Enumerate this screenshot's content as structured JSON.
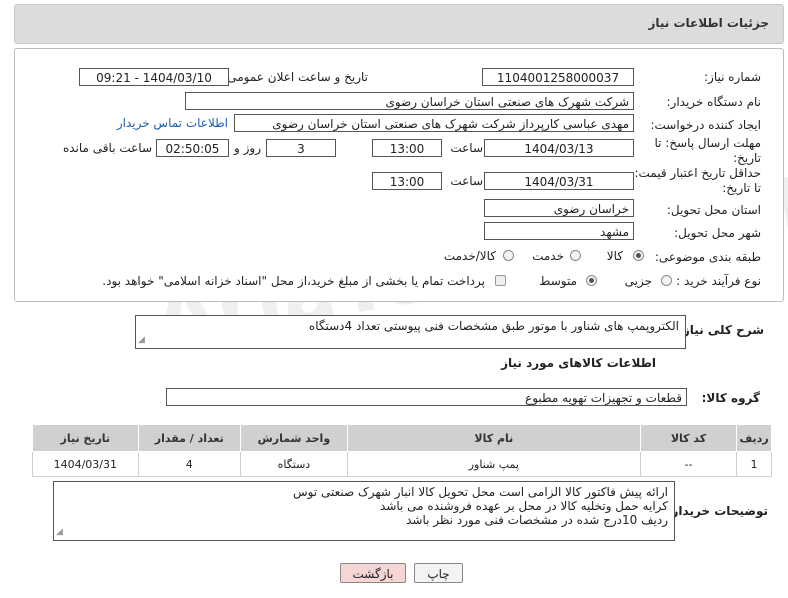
{
  "header": {
    "title": "جزئیات اطلاعات نیاز"
  },
  "form": {
    "need_number_label": "شماره نیاز:",
    "need_number": "1104001258000037",
    "announce_label": "تاریخ و ساعت اعلان عمومی:",
    "announce_value": "1404/03/10 - 09:21",
    "buyer_org_label": "نام دستگاه خریدار:",
    "buyer_org": "شرکت شهرک های صنعتی استان خراسان رضوی",
    "creator_label": "ایجاد کننده درخواست:",
    "creator": "مهدی عباسی کارپرداز شرکت شهرک های صنعتی استان خراسان رضوی",
    "contact_link": "اطلاعات تماس خریدار",
    "deadline_label_1": "مهلت ارسال پاسخ: تا",
    "deadline_label_2": "تاریخ:",
    "deadline_date": "1404/03/13",
    "hour_label": "ساعت",
    "deadline_time": "13:00",
    "days_value": "3",
    "days_label": "روز و",
    "remaining_time": "02:50:05",
    "remaining_label": "ساعت باقی مانده",
    "validity_label_1": "حداقل تاریخ اعتبار قیمت:",
    "validity_label_2": "تا تاریخ:",
    "validity_date": "1404/03/31",
    "validity_time": "13:00",
    "province_label": "استان محل تحویل:",
    "province": "خراسان رضوی",
    "city_label": "شهر محل تحویل:",
    "city": "مشهد",
    "category_label": "طبقه بندی موضوعی:",
    "category_options": [
      "کالا",
      "خدمت",
      "کالا/خدمت"
    ],
    "process_label": "نوع فرآیند خرید :",
    "process_options": [
      "جزیی",
      "متوسط"
    ],
    "payment_note": "پرداخت تمام یا بخشی از مبلغ خرید،از محل \"اسناد خزانه اسلامی\" خواهد بود."
  },
  "description": {
    "label": "شرح کلی نیاز:",
    "text": "الکتروپمپ های شناور با موتور طبق مشخصات فنی پیوستی      تعداد 4دستگاه"
  },
  "goods": {
    "section_title": "اطلاعات کالاهای مورد نیاز",
    "group_label": "گروه کالا:",
    "group_value": "قطعات و تجهیزات تهویه مطبوع",
    "columns": [
      "ردیف",
      "کد کالا",
      "نام کالا",
      "واحد شمارش",
      "تعداد / مقدار",
      "تاریخ نیاز"
    ],
    "rows": [
      {
        "row": "1",
        "code": "--",
        "name": "پمپ شناور",
        "unit": "دستگاه",
        "qty": "4",
        "date": "1404/03/31"
      }
    ]
  },
  "buyer_notes": {
    "label": "توضیحات خریدار:",
    "lines": [
      "ارائه پیش فاکتور کالا الزامی است            محل تحویل کالا انبار شهرک صنعتی توس",
      "کرایه حمل وتخلیه کالا در محل بر عهده فروشنده می باشد",
      "ردیف 10درج شده در مشخصات فنی مورد نظر باشد"
    ]
  },
  "buttons": {
    "print": "چاپ",
    "back": "بازگشت"
  },
  "watermark": "AriaTender.neT",
  "colors": {
    "header_bg": "#dcdcdc",
    "link": "#1a5fb4",
    "back_button_bg": "#f6d5d5",
    "table_header_bg": "#d0d0d0"
  }
}
